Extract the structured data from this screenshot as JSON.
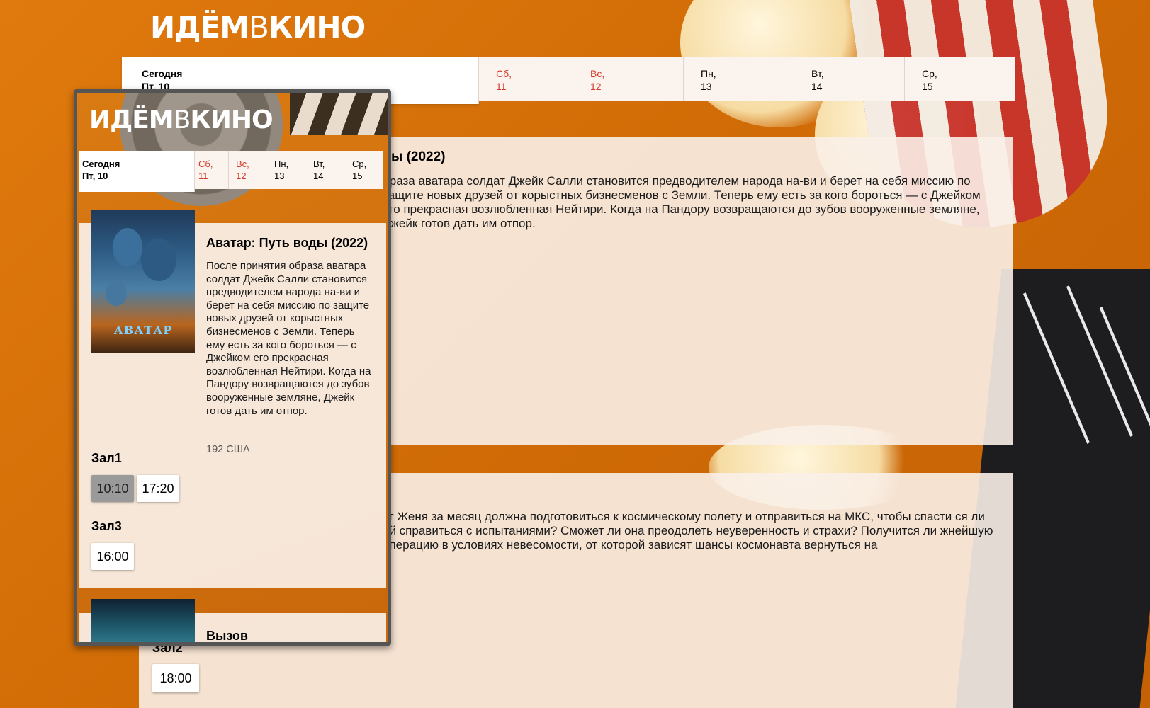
{
  "brand": {
    "logo_left": "ИДЁМ",
    "logo_mid": "В",
    "logo_right": "КИНО"
  },
  "days": [
    {
      "label": "Сегодня",
      "date": "Пт, 10",
      "weekend": false
    },
    {
      "label": "Сб,",
      "date": "11",
      "weekend": true
    },
    {
      "label": "Вс,",
      "date": "12",
      "weekend": true
    },
    {
      "label": "Пн,",
      "date": "13",
      "weekend": false
    },
    {
      "label": "Вт,",
      "date": "14",
      "weekend": false
    },
    {
      "label": "Ср,",
      "date": "15",
      "weekend": false
    }
  ],
  "background_page": {
    "movie1_title_fragment": "ды (2022)",
    "movie1_desc_fragment": "браза аватара солдат Джейк Салли становится предводителем народа на-ви и берет на себя миссию по защите новых друзей от корыстных бизнесменов с Земли. Теперь ему есть за кого бороться — с Джейком его прекрасная возлюбленная Нейтири. Когда на Пандору возвращаются до зубов вооруженные земляне, Джейк готов дать им отпор.",
    "movie2_desc_fragment": "рг Женя за месяц должна подготовиться к космическому полету и отправиться на МКС, чтобы спасти ся ли ей справиться с испытаниями? Сможет ли она преодолеть неуверенность и страхи? Получится ли жнейшую операцию в условиях невесомости, от которой зависят шансы космонавта вернуться на",
    "hall": "Зал2",
    "time": "18:00"
  },
  "phone": {
    "movie1": {
      "poster_text": "АВАТАР",
      "title": "Аватар: Путь воды (2022)",
      "description": "После принятия образа аватара солдат Джейк Салли становится предводителем народа на-ви и берет на себя миссию по защите новых друзей от корыстных бизнесменов с Земли. Теперь ему есть за кого бороться — с Джейком его прекрасная возлюбленная Нейтири. Когда на Пандору возвращаются до зубов вооруженные земляне, Джейк готов дать им отпор.",
      "meta": "192 США",
      "halls": [
        {
          "name": "Зал1",
          "times": [
            "10:10",
            "17:20"
          ],
          "selected": "10:10"
        },
        {
          "name": "Зал3",
          "times": [
            "16:00"
          ],
          "selected": ""
        }
      ]
    },
    "movie2": {
      "title": "Вызов"
    }
  },
  "colors": {
    "background": "#d16c06",
    "weekend_text": "#d23a2b",
    "card_bg": "#faf0e8",
    "selected_time_bg": "#9a9a9a"
  }
}
